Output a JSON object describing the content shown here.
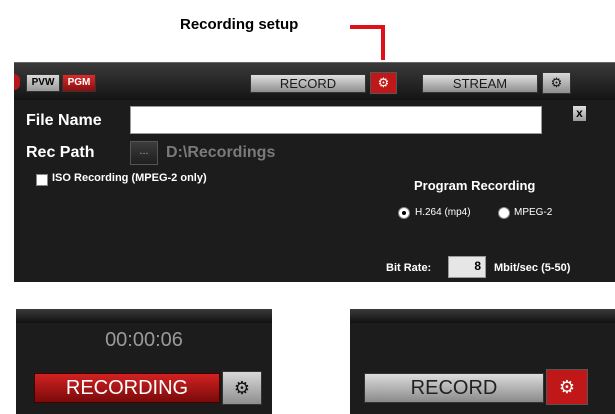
{
  "callout": {
    "title": "Recording setup"
  },
  "toolbar": {
    "pvw_label": "PVW",
    "pgm_label": "PGM",
    "record_label": "RECORD",
    "stream_label": "STREAM"
  },
  "form": {
    "file_name_label": "File Name",
    "file_name_value": "",
    "close_label": "x",
    "rec_path_label": "Rec Path",
    "browse_label": "...",
    "rec_path_value": "D:\\Recordings",
    "iso_label": "ISO Recording (MPEG-2 only)",
    "iso_checked": false
  },
  "program_recording": {
    "title": "Program Recording",
    "options": [
      {
        "label": "H.264 (mp4)",
        "selected": true
      },
      {
        "label": "MPEG-2",
        "selected": false
      }
    ],
    "bitrate_label": "Bit Rate:",
    "bitrate_value": "8",
    "bitrate_unit": "Mbit/sec (5-50)"
  },
  "recording_state": {
    "timer": "00:00:06",
    "button_label": "RECORDING"
  },
  "idle_state": {
    "button_label": "RECORD"
  },
  "icons": {
    "gear": "gear-icon",
    "close": "close-icon"
  },
  "colors": {
    "accent_red": "#c01818",
    "callout_red": "#e0101a",
    "panel_bg": "#1c1c1c"
  }
}
